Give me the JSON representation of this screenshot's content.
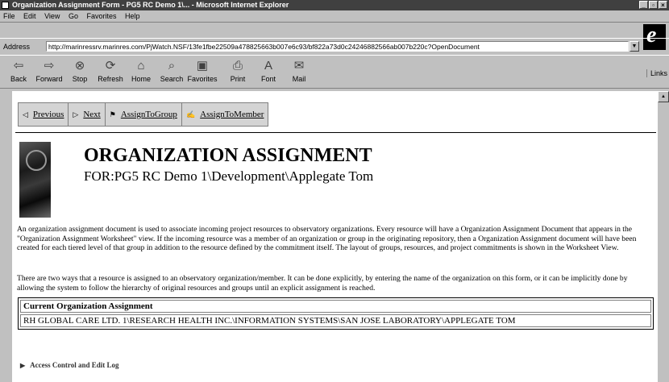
{
  "window": {
    "title": "Organization Assignment Form - PG5 RC Demo 1\\... - Microsoft Internet Explorer",
    "buttons": [
      "_",
      "▫",
      "×"
    ]
  },
  "menu": {
    "items": [
      "File",
      "Edit",
      "View",
      "Go",
      "Favorites",
      "Help"
    ]
  },
  "address": {
    "label": "Address",
    "url": "http://marinressrv.marinres.com/PjWatch.NSF/13fe1fbe22509a478825663b007e6c93/bf822a73d0c24246882566ab007b220c?OpenDocument"
  },
  "toolbar": {
    "buttons": [
      "Back",
      "Forward",
      "Stop",
      "Refresh",
      "Home",
      "Search",
      "Favorites",
      "Print",
      "Font",
      "Mail"
    ],
    "links_label": "Links"
  },
  "actions": {
    "previous": "Previous",
    "next": "Next",
    "assign_group": "AssignToGroup",
    "assign_member": "AssignToMember"
  },
  "page": {
    "title": "ORGANIZATION ASSIGNMENT",
    "subtitle": "FOR:PG5 RC Demo 1\\Development\\Applegate Tom",
    "para1": "An organization assignment document is used to associate incoming project resources to observatory organizations. Every resource will have a Organization Assignment Document that appears in the \"Organization Assignment Worksheet\" view. If the incoming resource was a member of an organization or group in the originating repository, then a Organization Assignment document will have been created for each tiered level of that group in addition to the resource defined by the commitment itself. The layout of groups, resources, and project commitments is shown in the Worksheet View.",
    "para2": "There are two ways that a resource is assigned to an observatory organization/member. It can be done explicitly, by entering the name of the organization on this form, or it can be implicitly done by allowing the system to follow the hierarchy of original resources and groups until an explicit assignment is reached.",
    "table_header": "Current Organization Assignment",
    "table_value": "RH GLOBAL CARE LTD. 1\\RESEARCH HEALTH INC.\\INFORMATION SYSTEMS\\SAN JOSE LABORATORY\\APPLEGATE TOM",
    "access_log": "Access Control and Edit Log"
  }
}
